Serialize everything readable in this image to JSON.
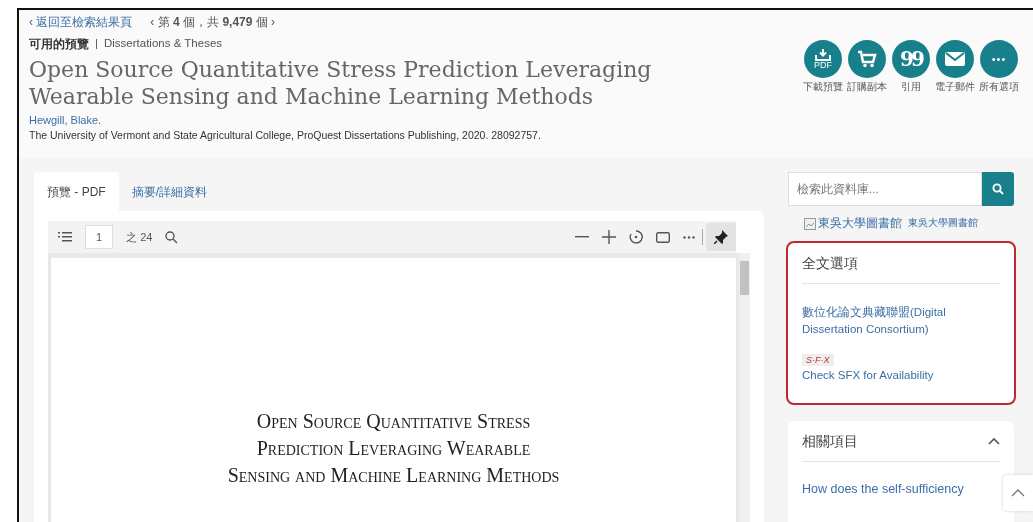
{
  "nav": {
    "back": "‹ 返回至檢索結果頁",
    "position": "‹ 第 **4** 個，共 **9,479** 個 ›"
  },
  "meta": {
    "availability": "可用的預覽",
    "separator": "|",
    "source": "Dissertations & Theses"
  },
  "title": "Open Source Quantitative Stress Prediction Leveraging Wearable Sensing and Machine Learning Methods",
  "author": "Hewgill, Blake.",
  "publication": "The University of Vermont and State Agricultural College, ProQuest Dissertations Publishing, 2020. 28092757.",
  "actions": [
    {
      "kind": "pdf",
      "icon_text": "PDF",
      "label": "下載預覽"
    },
    {
      "kind": "cart",
      "label": "訂購副本"
    },
    {
      "kind": "quote",
      "icon_text": "99",
      "label": "引用"
    },
    {
      "kind": "mail",
      "label": "電子郵件"
    },
    {
      "kind": "more",
      "icon_text": "•••",
      "label": "所有選項"
    }
  ],
  "tabs": [
    {
      "label": "預覽 - PDF",
      "selected": true
    },
    {
      "label": "摘要/詳細資料",
      "selected": false
    }
  ],
  "viewer": {
    "page": "1",
    "page_count": "之 24",
    "page_title_lines": [
      "Open Source Quantitative Stress",
      "Prediction Leveraging Wearable",
      "Sensing and Machine Learning Methods"
    ]
  },
  "search": {
    "placeholder": "檢索此資料庫..."
  },
  "library": {
    "image_alt": "東吳大學圖書館",
    "name": "東吳大學圖書館"
  },
  "fulltext": {
    "heading": "全文選項",
    "link": "數位化論文典藏聯盟(Digital Dissertation Consortium)",
    "sfx_logo": "S·F·X",
    "sfx_link": "Check SFX for Availability"
  },
  "related": {
    "heading": "相關項目",
    "expanded": true,
    "items": [
      "How does the self-sufficiency"
    ]
  }
}
